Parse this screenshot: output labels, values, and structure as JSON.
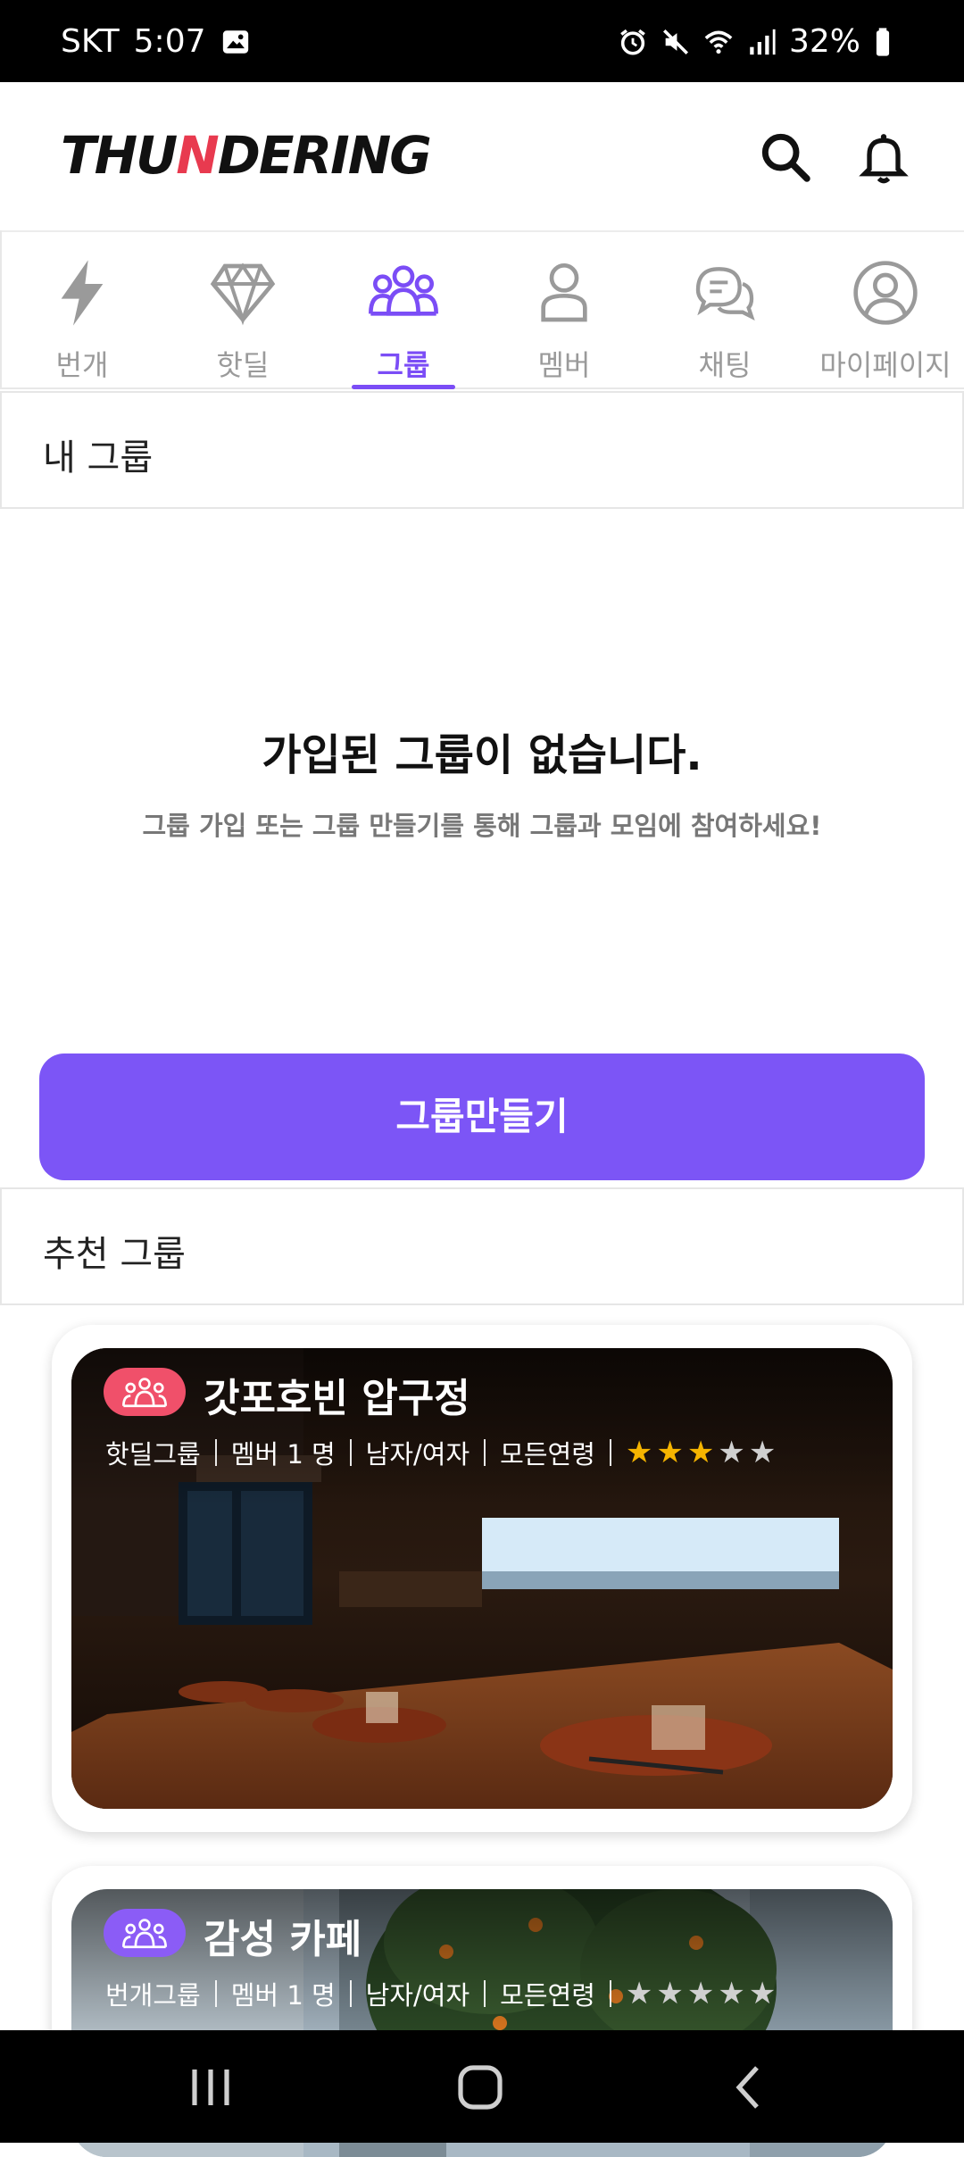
{
  "status_bar": {
    "carrier": "SKT",
    "time": "5:07",
    "battery": "32%",
    "icons": [
      "gallery-icon",
      "alarm-icon",
      "mute-icon",
      "wifi-icon",
      "signal-icon",
      "battery-icon"
    ]
  },
  "header": {
    "logo_text_a": "THU",
    "logo_text_b": "N",
    "logo_text_c": "DERING",
    "icons": [
      "search-icon",
      "bell-icon"
    ]
  },
  "tabs": [
    {
      "label": "번개",
      "icon": "lightning-icon",
      "active": false
    },
    {
      "label": "핫딜",
      "icon": "diamond-icon",
      "active": false
    },
    {
      "label": "그룹",
      "icon": "group-icon",
      "active": true
    },
    {
      "label": "멤버",
      "icon": "person-icon",
      "active": false
    },
    {
      "label": "채팅",
      "icon": "chat-icon",
      "active": false
    },
    {
      "label": "마이페이지",
      "icon": "profile-icon",
      "active": false
    }
  ],
  "my_groups": {
    "title": "내 그룹",
    "empty_title": "가입된 그룹이 없습니다.",
    "empty_sub": "그룹 가입 또는 그룹 만들기를 통해 그룹과 모임에 참여하세요!",
    "create_button": "그룹만들기"
  },
  "recommended": {
    "title": "추천 그룹",
    "cards": [
      {
        "title": "갓포호빈 압구정",
        "type": "핫딜그룹",
        "members": "멤버 1 명",
        "gender": "남자/여자",
        "age": "모든연령",
        "rating": 3,
        "max_rating": 5,
        "badge_color": "#f0506a"
      },
      {
        "title": "감성 카페",
        "type": "번개그룹",
        "members": "멤버 1 명",
        "gender": "남자/여자",
        "age": "모든연령",
        "rating": 0,
        "max_rating": 5,
        "badge_color": "#8b5cf6"
      }
    ]
  },
  "colors": {
    "accent": "#7b4df6",
    "logo_bolt": "#e83a4f",
    "star_on": "#f5b400",
    "star_off": "#d0d0d0"
  }
}
